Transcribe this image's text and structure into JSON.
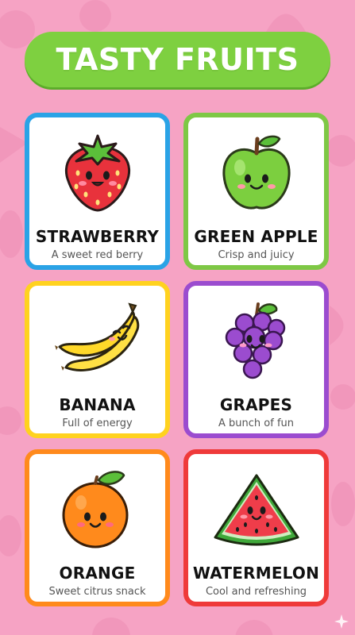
{
  "title": "TASTY FRUITS",
  "colors": {
    "background": "#f6a3c4",
    "title_pill": "#7ed040"
  },
  "cards": [
    {
      "name": "STRAWBERRY",
      "description": "A sweet red berry",
      "icon": "strawberry-icon",
      "border_color": "#2aa3e6"
    },
    {
      "name": "GREEN APPLE",
      "description": "Crisp and juicy",
      "icon": "green-apple-icon",
      "border_color": "#7ec845"
    },
    {
      "name": "BANANA",
      "description": "Full of energy",
      "icon": "banana-icon",
      "border_color": "#ffd21f"
    },
    {
      "name": "GRAPES",
      "description": "A bunch of fun",
      "icon": "grapes-icon",
      "border_color": "#9b4ccf"
    },
    {
      "name": "ORANGE",
      "description": "Sweet citrus snack",
      "icon": "orange-icon",
      "border_color": "#ff8a1c"
    },
    {
      "name": "WATERMELON",
      "description": "Cool and refreshing",
      "icon": "watermelon-icon",
      "border_color": "#ef3a3a"
    }
  ]
}
